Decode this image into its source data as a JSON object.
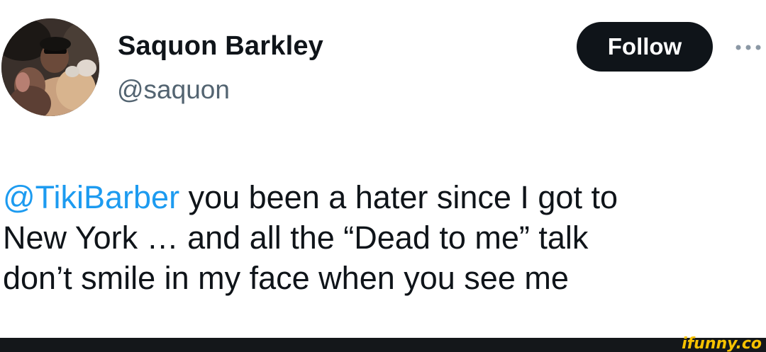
{
  "author": {
    "display_name": "Saquon Barkley",
    "handle": "@saquon",
    "avatar": "profile-photo"
  },
  "follow_button": {
    "label": "Follow"
  },
  "more_menu": {
    "icon": "more-horizontal-icon"
  },
  "tweet": {
    "mention": "@TikiBarber",
    "line1_rest": " you been a hater since I got to",
    "line2": "New York … and all the “Dead to me” talk",
    "line3": "don’t smile in my face when you see me"
  },
  "watermark": {
    "text": "ifunny.co"
  },
  "colors": {
    "mention": "#1d9bf0",
    "text": "#0f1419",
    "secondary": "#536471",
    "button_bg": "#0f1419",
    "watermark": "#f7c200",
    "footer": "#14171a"
  }
}
